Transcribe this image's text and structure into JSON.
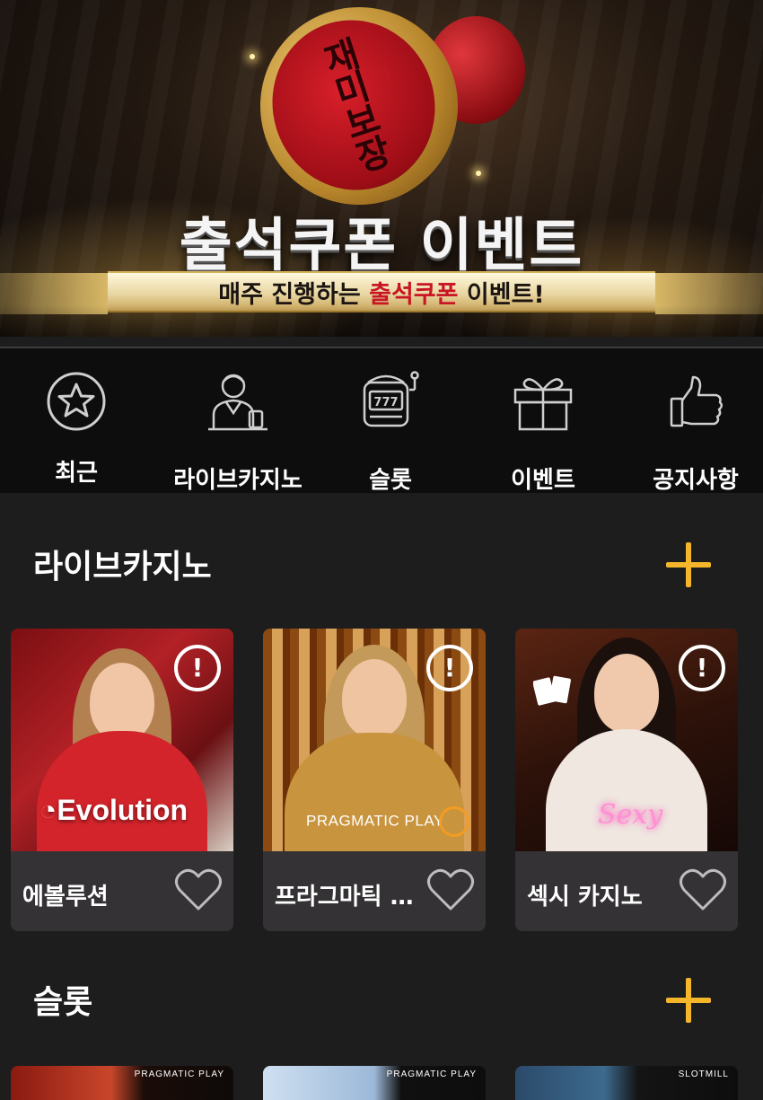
{
  "banner": {
    "title": "출석쿠폰 이벤트",
    "subtitle_prefix": "매주 진행하는 ",
    "subtitle_highlight": "출석쿠폰",
    "subtitle_suffix": " 이벤트!",
    "stamp_text": "재미보장"
  },
  "categories": [
    {
      "label": "최근",
      "icon": "star-circle-icon"
    },
    {
      "label": "라이브카지노",
      "icon": "dealer-icon"
    },
    {
      "label": "슬롯",
      "icon": "slot-machine-icon"
    },
    {
      "label": "이벤트",
      "icon": "gift-icon"
    },
    {
      "label": "공지사항",
      "icon": "thumbs-up-icon"
    }
  ],
  "live_casino": {
    "title": "라이브카지노",
    "more_icon": "plus-icon",
    "games": [
      {
        "name": "에볼루션",
        "brand": "Evolution",
        "info": "!"
      },
      {
        "name": "프라그마틱 플레이",
        "brand": "PRAGMATIC PLAY",
        "info": "!"
      },
      {
        "name": "섹시 카지노",
        "brand": "Sexy",
        "info": "!"
      }
    ]
  },
  "slots": {
    "title": "슬롯",
    "more_icon": "plus-icon",
    "providers": [
      "PRAGMATIC PLAY",
      "PRAGMATIC PLAY",
      "SLOTMILL"
    ]
  },
  "colors": {
    "accent": "#f5b62a",
    "background": "#1e1d1e",
    "nav_background": "#0d0d0e",
    "card_background": "#343234",
    "highlight_red": "#c81624"
  }
}
